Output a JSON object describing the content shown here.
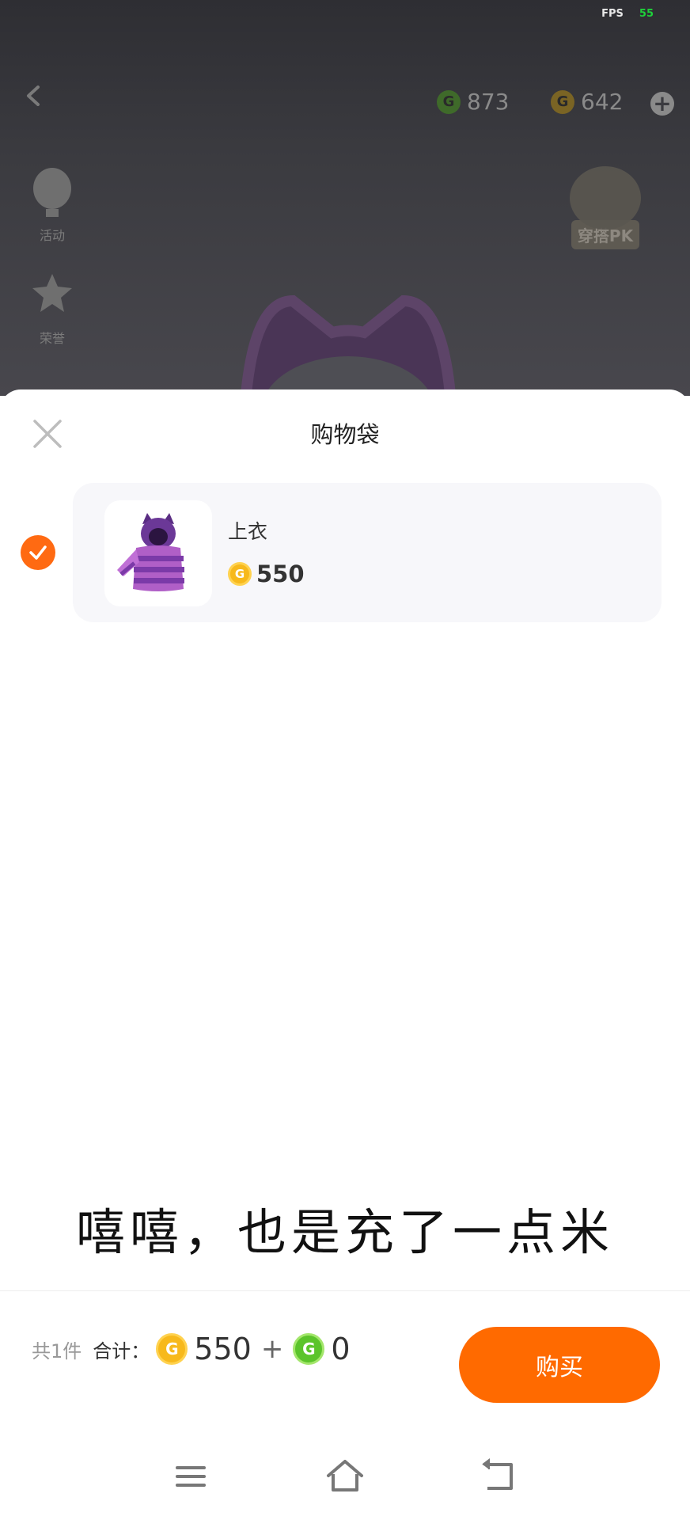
{
  "status": {
    "fps_label": "FPS",
    "fps_value": "55"
  },
  "background": {
    "currency_green": "873",
    "currency_gold": "642",
    "side_items": [
      "活动",
      "荣誉"
    ],
    "pk_label": "穿搭PK"
  },
  "sheet": {
    "title": "购物袋",
    "items": [
      {
        "name": "上衣",
        "price": "550",
        "checked": true
      }
    ]
  },
  "caption": "嘻嘻，也是充了一点米",
  "footer": {
    "count": "共1件",
    "total_label": "合计：",
    "gold_total": "550",
    "plus": "+",
    "green_total": "0",
    "buy_label": "购买"
  },
  "icons": {
    "close": "close-icon",
    "check": "check-icon",
    "gold_coin": "gold-coin-icon",
    "green_coin": "green-coin-icon",
    "menu": "menu-icon",
    "home": "home-icon",
    "back": "back-icon"
  },
  "colors": {
    "accent": "#ff6a00",
    "gold": "#f7b91c",
    "green": "#5bc42b",
    "fps": "#1ed03a"
  }
}
